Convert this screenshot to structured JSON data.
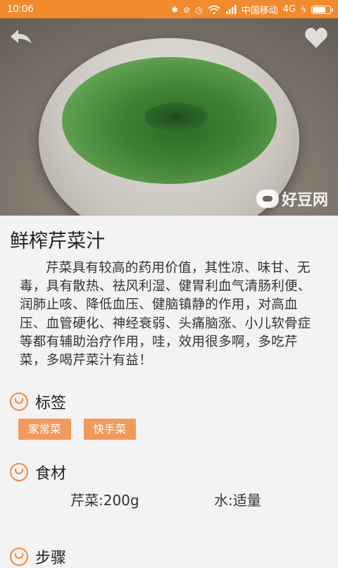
{
  "status_bar": {
    "time": "10:06",
    "carrier": "中国移动",
    "network": "4G",
    "icons": [
      "bluetooth-icon",
      "alarm-muted-icon",
      "alarm-icon",
      "wifi-icon",
      "signal-icon",
      "charging-icon",
      "battery-icon"
    ],
    "color": "#f28a2e"
  },
  "hero": {
    "watermark": "好豆网"
  },
  "recipe": {
    "title": "鲜榨芹菜汁",
    "description": "芹菜具有较高的药用价值，其性凉、味甘、无毒，具有散热、祛风利湿、健胃利血气清肠利便、润肺止咳、降低血压、健脑镇静的作用，对高血压、血管硬化、神经衰弱、头痛脑涨、小儿软骨症等都有辅助治疗作用，哇，效用很多啊，多吃芹菜，多喝芹菜汁有益！"
  },
  "sections": {
    "tags_title": "标签",
    "ingredients_title": "食材",
    "steps_title": "步骤"
  },
  "tags": [
    "家常菜",
    "快手菜"
  ],
  "ingredients": [
    {
      "name": "芹菜",
      "amount": "200g",
      "text": "芹菜:200g"
    },
    {
      "name": "水",
      "amount": "适量",
      "text": "水:适量"
    }
  ],
  "colors": {
    "accent": "#f08a3c",
    "tag_bg": "#f29a5c"
  }
}
